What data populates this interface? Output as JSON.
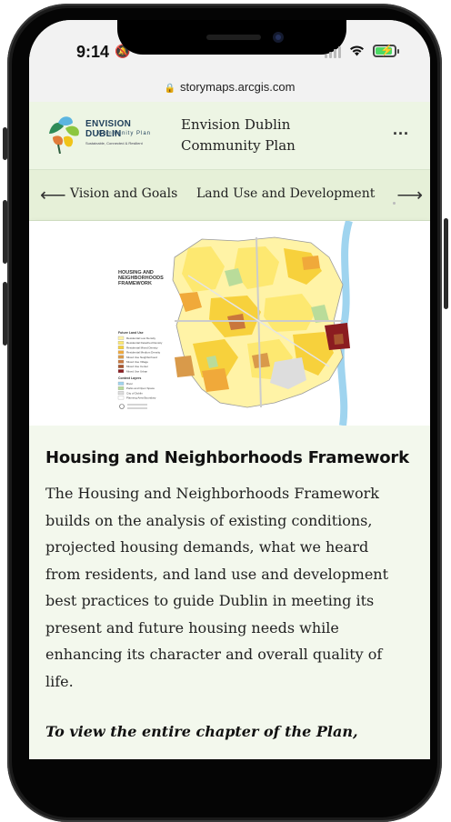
{
  "status_bar": {
    "time": "9:14",
    "signal_bars": 4
  },
  "browser": {
    "url": "storymaps.arcgis.com"
  },
  "header": {
    "logo": {
      "title": "ENVISION DUBLIN",
      "subtitle": "Community Plan",
      "tagline": "Sustainable, Connected & Resilient"
    },
    "title_line1": "Envision Dublin",
    "title_line2": "Community Plan",
    "menu_label": "..."
  },
  "nav": {
    "items": [
      "Vision and Goals",
      "Land Use and Development"
    ]
  },
  "map": {
    "title_lines": [
      "HOUSING AND",
      "NEIGHBORHOODS",
      "FRAMEWORK"
    ],
    "legend_heading": "Future Land Use",
    "legend_items": [
      {
        "label": "Residential Low Density",
        "color": "#fff3a6"
      },
      {
        "label": "Residential Detached Density",
        "color": "#fde870"
      },
      {
        "label": "Residential Mixed Density",
        "color": "#f7d13c"
      },
      {
        "label": "Residential Medium Density",
        "color": "#f0a93a"
      },
      {
        "label": "Mixed Use Neighborhood",
        "color": "#d99a4a"
      },
      {
        "label": "Mixed Use Village",
        "color": "#c9773c"
      },
      {
        "label": "Mixed Use Center",
        "color": "#a8552e"
      },
      {
        "label": "Mixed Use Urban",
        "color": "#8b1c20"
      }
    ],
    "context_heading": "Context Layers",
    "context_items": [
      {
        "label": "River",
        "color": "#9fd4ef"
      },
      {
        "label": "Parks and Open Space",
        "color": "#b9dc9a"
      },
      {
        "label": "City of Dublin",
        "color": "#dddddd"
      },
      {
        "label": "Planning Area Boundary",
        "color": "#ffffff"
      }
    ]
  },
  "article": {
    "heading": "Housing and Neighborhoods Framework",
    "paragraph_lines": [
      "The Housing and Neighborhoods Framework",
      "builds on the analysis of existing conditions,",
      "projected housing demands, what we heard",
      "from residents, and land use and development",
      "best practices to guide Dublin in meeting its",
      "present and future housing needs while",
      "enhancing its character and overall quality of",
      "life."
    ],
    "cta_line1": "To view the entire chapter of the Plan,"
  },
  "colors": {
    "page_bg": "#f3f8ed",
    "header_bg": "#edf5e4",
    "nav_bg": "#e6f0d8"
  }
}
